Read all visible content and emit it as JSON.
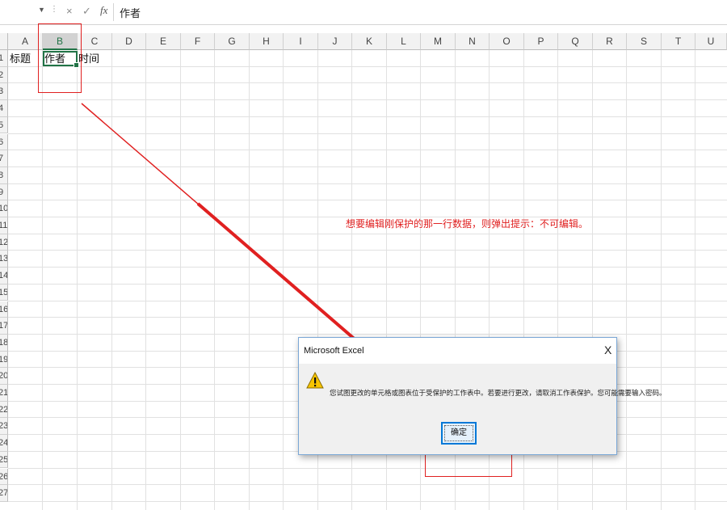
{
  "formula_bar": {
    "cancel_symbol": "×",
    "enter_symbol": "✓",
    "fx_label": "fx",
    "value": "作者"
  },
  "columns": [
    "A",
    "B",
    "C",
    "D",
    "E",
    "F",
    "G",
    "H",
    "I",
    "J",
    "K",
    "L",
    "M",
    "N",
    "O",
    "P",
    "Q",
    "R",
    "S",
    "T",
    "U"
  ],
  "selected_column": "B",
  "rows": [
    "1",
    "2",
    "3",
    "4",
    "5",
    "6",
    "7",
    "8",
    "9",
    "10",
    "11",
    "12",
    "13",
    "14",
    "15",
    "16",
    "17",
    "18",
    "19",
    "20",
    "21",
    "22",
    "23",
    "24",
    "25",
    "26",
    "27"
  ],
  "cells": {
    "A1": "标题",
    "B1": "作者",
    "C1": "时间"
  },
  "annotation": {
    "note": "想要编辑刚保护的那一行数据，则弹出提示：不可编辑。",
    "color": "#e02020"
  },
  "dialog": {
    "title": "Microsoft Excel",
    "close_label": "X",
    "message": "您试图更改的单元格或图表位于受保护的工作表中。若要进行更改，请取消工作表保护。您可能需要输入密码。",
    "ok_label": "确定"
  },
  "colors": {
    "accent": "#217346",
    "dialog_button_border": "#0078d7"
  }
}
